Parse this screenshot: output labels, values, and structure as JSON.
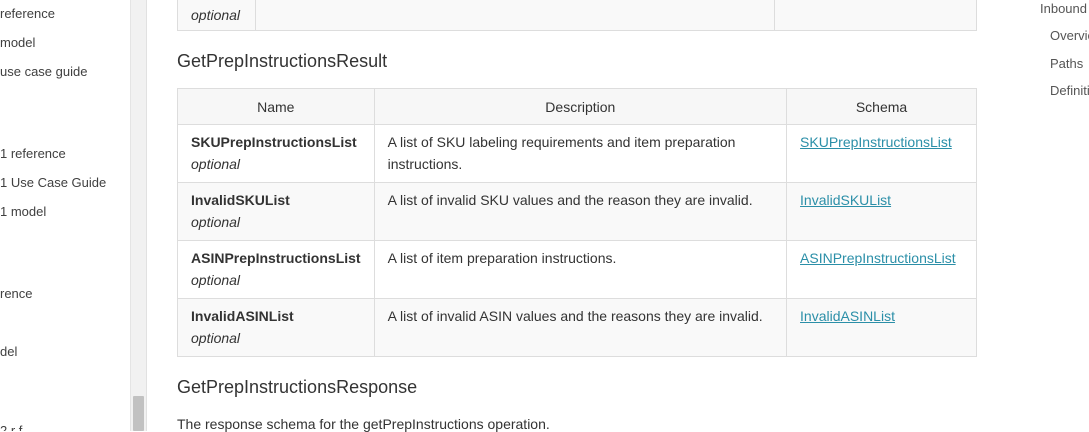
{
  "left_nav": {
    "items": [
      {
        "label": "reference"
      },
      {
        "label": "model"
      },
      {
        "label": "use case guide"
      },
      {
        "label": "1 reference"
      },
      {
        "label": "1 Use Case Guide"
      },
      {
        "label": "1 model"
      },
      {
        "label": "rence"
      },
      {
        "label": "del"
      },
      {
        "label": "2 r f"
      }
    ]
  },
  "top_table": {
    "fragment_optional": "optional"
  },
  "section_result": {
    "heading": "GetPrepInstructionsResult",
    "columns": [
      "Name",
      "Description",
      "Schema"
    ],
    "rows": [
      {
        "name": "SKUPrepInstructionsList",
        "qualifier": "optional",
        "description": "A list of SKU labeling requirements and item preparation instructions.",
        "schema": "SKUPrepInstructionsList"
      },
      {
        "name": "InvalidSKUList",
        "qualifier": "optional",
        "description": "A list of invalid SKU values and the reason they are invalid.",
        "schema": "InvalidSKUList"
      },
      {
        "name": "ASINPrepInstructionsList",
        "qualifier": "optional",
        "description": "A list of item preparation instructions.",
        "schema": "ASINPrepInstructionsList"
      },
      {
        "name": "InvalidASINList",
        "qualifier": "optional",
        "description": "A list of invalid ASIN values and the reasons they are invalid.",
        "schema": "InvalidASINList"
      }
    ]
  },
  "section_response": {
    "heading": "GetPrepInstructionsResponse",
    "description": "The response schema for the getPrepInstructions operation."
  },
  "right_toc": {
    "items": [
      {
        "label": "Inbound"
      },
      {
        "label": "Overvie"
      },
      {
        "label": "Paths"
      },
      {
        "label": "Definiti"
      }
    ]
  },
  "colors": {
    "link": "#2b8fa8",
    "border": "#dddddd",
    "text": "#333333"
  }
}
